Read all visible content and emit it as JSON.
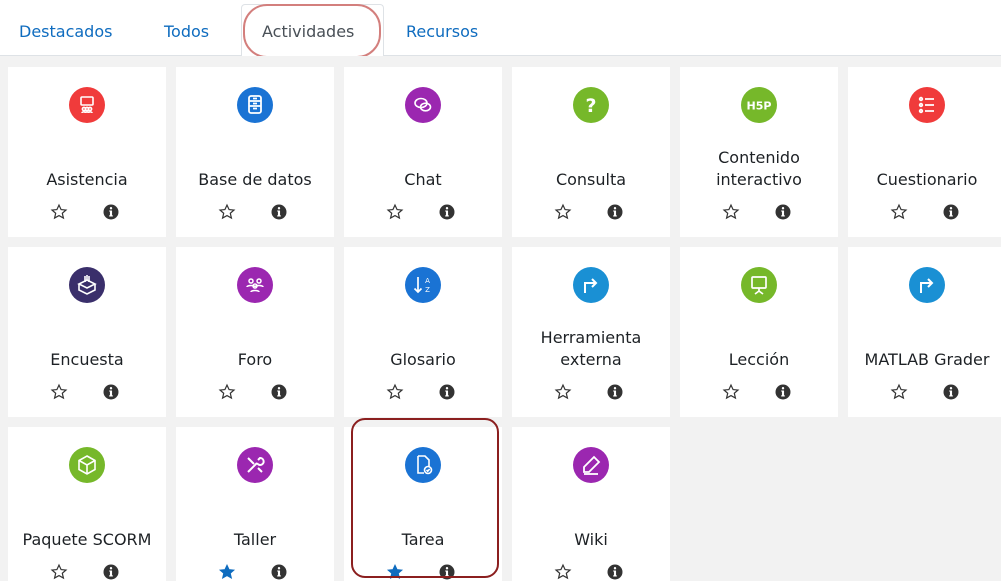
{
  "tabs": [
    {
      "label": "Destacados"
    },
    {
      "label": "Todos"
    },
    {
      "label": "Actividades"
    },
    {
      "label": "Recursos"
    }
  ],
  "activities": [
    {
      "label": "Asistencia",
      "icon": "attendance-icon",
      "color": "#f03b3b",
      "starred": false
    },
    {
      "label": "Base de datos",
      "icon": "database-icon",
      "color": "#1a73d4",
      "starred": false
    },
    {
      "label": "Chat",
      "icon": "chat-icon",
      "color": "#9b27b0",
      "starred": false
    },
    {
      "label": "Consulta",
      "icon": "question-icon",
      "color": "#76b82a",
      "starred": false
    },
    {
      "label": "Contenido interactivo",
      "icon": "h5p-icon",
      "color": "#76b82a",
      "starred": false
    },
    {
      "label": "Cuestionario",
      "icon": "quiz-list-icon",
      "color": "#f03b3b",
      "starred": false
    },
    {
      "label": "Encuesta",
      "icon": "survey-box-icon",
      "color": "#3a2f6b",
      "starred": false
    },
    {
      "label": "Foro",
      "icon": "forum-people-icon",
      "color": "#9b27b0",
      "starred": false
    },
    {
      "label": "Glosario",
      "icon": "sort-az-icon",
      "color": "#1a73d4",
      "starred": false
    },
    {
      "label": "Herramienta externa",
      "icon": "external-arrow-icon",
      "color": "#1a90d4",
      "starred": false
    },
    {
      "label": "Lección",
      "icon": "presentation-icon",
      "color": "#76b82a",
      "starred": false
    },
    {
      "label": "MATLAB Grader",
      "icon": "external-arrow-icon",
      "color": "#1a90d4",
      "starred": false
    },
    {
      "label": "Paquete SCORM",
      "icon": "cube-icon",
      "color": "#76b82a",
      "starred": false
    },
    {
      "label": "Taller",
      "icon": "tools-icon",
      "color": "#9b27b0",
      "starred": true
    },
    {
      "label": "Tarea",
      "icon": "assignment-icon",
      "color": "#1a73d4",
      "starred": true
    },
    {
      "label": "Wiki",
      "icon": "pencil-icon",
      "color": "#9b27b0",
      "starred": false
    }
  ]
}
